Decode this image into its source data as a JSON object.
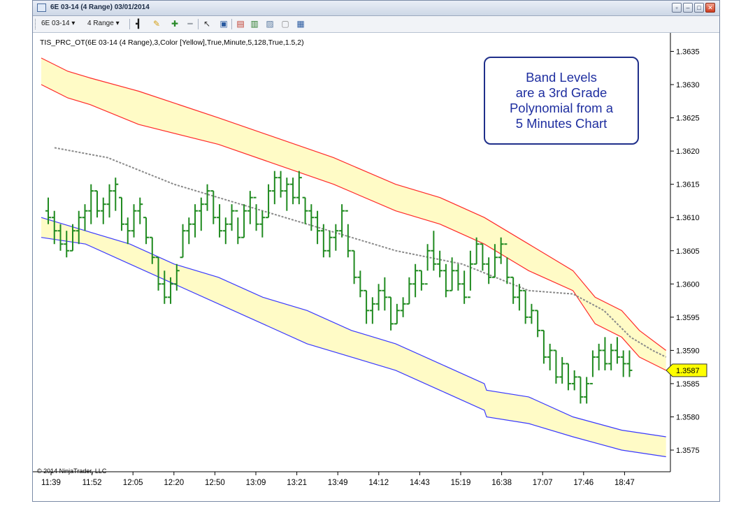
{
  "window": {
    "title": "6E 03-14 (4 Range)  03/01/2014",
    "controls": [
      "restore-icon",
      "minimize-icon",
      "maximize-icon",
      "close-icon"
    ]
  },
  "toolbar": {
    "instrument": "6E 03-14 ▾",
    "period": "4 Range ▾",
    "icons": [
      "bar-style-icon",
      "pencil-icon",
      "zoom-in-icon",
      "zoom-out-icon",
      "cursor-icon",
      "data-box-icon",
      "indicators-icon",
      "strategies-icon",
      "chart-properties-icon",
      "page-icon",
      "properties-icon"
    ]
  },
  "chart": {
    "indicator_label": "TIS_PRC_OT(6E 03-14 (4 Range),3,Color [Yellow],True,Minute,5,128,True,1.5,2)",
    "copyright": "© 2014 NinjaTrader, LLC",
    "price_tag": "1.3587",
    "note_lines": [
      "Band Levels",
      "are a 3rd Grade",
      "Polynomial from a",
      "5 Minutes Chart"
    ],
    "colors": {
      "band_fill": "#fffbc6",
      "upper_line": "#ff2a2a",
      "lower_line": "#3a3aff",
      "bars": "#1f8a1f",
      "midline": "#8a8a8a",
      "tag": "#ffff00"
    }
  },
  "chart_data": {
    "type": "line",
    "title": "",
    "xlabel": "",
    "ylabel": "",
    "ylim": [
      1.3571,
      1.3638
    ],
    "y_ticks": [
      "1.3635",
      "1.3630",
      "1.3625",
      "1.3620",
      "1.3615",
      "1.3610",
      "1.3605",
      "1.3600",
      "1.3595",
      "1.3590",
      "1.3585",
      "1.3580",
      "1.3575"
    ],
    "x_ticks": [
      "11:39",
      "11:52",
      "12:05",
      "12:20",
      "12:50",
      "13:09",
      "13:21",
      "13:49",
      "14:12",
      "14:43",
      "15:19",
      "16:38",
      "17:07",
      "17:46",
      "18:47"
    ],
    "last_price": 1.3587,
    "series": [
      {
        "kind": "band",
        "x": [
          0,
          6,
          11,
          22,
          40,
          66,
          80,
          90,
          100,
          110,
          120,
          125,
          131,
          135,
          141
        ],
        "upper": [
          1.3634,
          1.3632,
          1.3631,
          1.3629,
          1.3625,
          1.3619,
          1.3615,
          1.3613,
          1.361,
          1.3606,
          1.3602,
          1.3598,
          1.3596,
          1.3593,
          1.359
        ],
        "lower": [
          1.363,
          1.3628,
          1.3627,
          1.3624,
          1.3621,
          1.3615,
          1.3611,
          1.3609,
          1.3606,
          1.3602,
          1.3599,
          1.3594,
          1.3592,
          1.3589,
          1.3587
        ]
      },
      {
        "kind": "band",
        "x": [
          0,
          10,
          20,
          30,
          40,
          50,
          60,
          70,
          80,
          90,
          100,
          100.5,
          110,
          120,
          131,
          141
        ],
        "upper": [
          1.361,
          1.3608,
          1.3606,
          1.3603,
          1.3601,
          1.3598,
          1.3596,
          1.3593,
          1.3591,
          1.3588,
          1.3585,
          1.3584,
          1.3583,
          1.358,
          1.3578,
          1.3577
        ],
        "lower": [
          1.3607,
          1.3606,
          1.3603,
          1.36,
          1.3597,
          1.3594,
          1.3591,
          1.3589,
          1.3587,
          1.3584,
          1.3581,
          1.358,
          1.3579,
          1.3577,
          1.3575,
          1.3574
        ]
      },
      {
        "kind": "midline",
        "x": [
          3,
          15,
          30,
          50,
          65,
          80,
          95,
          110,
          120,
          127,
          133,
          138,
          141
        ],
        "y": [
          1.36205,
          1.3619,
          1.3615,
          1.3611,
          1.3608,
          1.3605,
          1.3603,
          1.3599,
          1.35985,
          1.3596,
          1.3592,
          1.359,
          1.3589
        ]
      },
      {
        "kind": "bars",
        "x_start": 3,
        "x_step": 1.0,
        "bars": [
          [
            1.3613,
            1.3609,
            1.3611,
            1.361
          ],
          [
            1.3611,
            1.3606,
            1.361,
            1.3608
          ],
          [
            1.3609,
            1.3605,
            1.3608,
            1.3606
          ],
          [
            1.3608,
            1.3604,
            1.3606,
            1.3605
          ],
          [
            1.3609,
            1.3605,
            1.3605,
            1.3608
          ],
          [
            1.3611,
            1.3606,
            1.3608,
            1.361
          ],
          [
            1.3612,
            1.3608,
            1.361,
            1.3611
          ],
          [
            1.3615,
            1.3609,
            1.3611,
            1.3614
          ],
          [
            1.3614,
            1.361,
            1.3614,
            1.3611
          ],
          [
            1.3613,
            1.3609,
            1.3611,
            1.3612
          ],
          [
            1.3615,
            1.361,
            1.3612,
            1.3614
          ],
          [
            1.3616,
            1.3611,
            1.3614,
            1.3615
          ],
          [
            1.3613,
            1.3608,
            1.3613,
            1.3609
          ],
          [
            1.361,
            1.3606,
            1.3609,
            1.3608
          ],
          [
            1.3612,
            1.3607,
            1.3608,
            1.3611
          ],
          [
            1.3613,
            1.3609,
            1.3611,
            1.3612
          ],
          [
            1.361,
            1.3606,
            1.361,
            1.3607
          ],
          [
            1.3607,
            1.3603,
            1.3607,
            1.3604
          ],
          [
            1.3604,
            1.3599,
            1.3604,
            1.36
          ],
          [
            1.3602,
            1.3597,
            1.36,
            1.3598
          ],
          [
            1.3601,
            1.3597,
            1.3598,
            1.36
          ],
          [
            1.3603,
            1.3599,
            1.36,
            1.3602
          ],
          [
            1.3609,
            1.3604,
            1.3604,
            1.3608
          ],
          [
            1.361,
            1.3606,
            1.3608,
            1.3609
          ],
          [
            1.3612,
            1.3607,
            1.3609,
            1.3611
          ],
          [
            1.3613,
            1.3608,
            1.3611,
            1.3612
          ],
          [
            1.3615,
            1.3611,
            1.3612,
            1.3614
          ],
          [
            1.3614,
            1.3609,
            1.3614,
            1.361
          ],
          [
            1.3612,
            1.3607,
            1.361,
            1.3608
          ],
          [
            1.361,
            1.3606,
            1.3608,
            1.3609
          ],
          [
            1.3612,
            1.3608,
            1.3609,
            1.3611
          ],
          [
            1.361,
            1.3606,
            1.3611,
            1.3607
          ],
          [
            1.3612,
            1.3607,
            1.3607,
            1.3611
          ],
          [
            1.3614,
            1.3609,
            1.3611,
            1.3613
          ],
          [
            1.3612,
            1.3608,
            1.3613,
            1.3609
          ],
          [
            1.3611,
            1.3607,
            1.3609,
            1.361
          ],
          [
            1.3615,
            1.361,
            1.361,
            1.3614
          ],
          [
            1.3617,
            1.3612,
            1.3614,
            1.3616
          ],
          [
            1.3617,
            1.3613,
            1.3616,
            1.3614
          ],
          [
            1.3616,
            1.3611,
            1.3614,
            1.3615
          ],
          [
            1.3616,
            1.3612,
            1.3615,
            1.3613
          ],
          [
            1.3617,
            1.3612,
            1.3613,
            1.3616
          ],
          [
            1.3613,
            1.3609,
            1.3613,
            1.3611
          ],
          [
            1.3612,
            1.3608,
            1.3611,
            1.361
          ],
          [
            1.3611,
            1.3606,
            1.361,
            1.3608
          ],
          [
            1.3609,
            1.3604,
            1.3608,
            1.3605
          ],
          [
            1.3608,
            1.3604,
            1.3605,
            1.3607
          ],
          [
            1.3609,
            1.3605,
            1.3607,
            1.3608
          ],
          [
            1.3612,
            1.3607,
            1.3608,
            1.3611
          ],
          [
            1.3609,
            1.3604,
            1.3611,
            1.3605
          ],
          [
            1.3605,
            1.36,
            1.3605,
            1.3601
          ],
          [
            1.3602,
            1.3598,
            1.3601,
            1.3599
          ],
          [
            1.3599,
            1.3594,
            1.3599,
            1.3596
          ],
          [
            1.3598,
            1.3594,
            1.3596,
            1.3597
          ],
          [
            1.36,
            1.3596,
            1.3597,
            1.3599
          ],
          [
            1.3601,
            1.3596,
            1.3599,
            1.3598
          ],
          [
            1.3598,
            1.3593,
            1.3598,
            1.3594
          ],
          [
            1.3597,
            1.3594,
            1.3594,
            1.3596
          ],
          [
            1.3598,
            1.3595,
            1.3596,
            1.3597
          ],
          [
            1.3601,
            1.3597,
            1.3597,
            1.36
          ],
          [
            1.3603,
            1.3598,
            1.36,
            1.3602
          ],
          [
            1.3602,
            1.3599,
            1.3602,
            1.36
          ],
          [
            1.3606,
            1.3602,
            1.36,
            1.3605
          ],
          [
            1.3608,
            1.3602,
            1.3605,
            1.3603
          ],
          [
            1.3605,
            1.3601,
            1.3603,
            1.3602
          ],
          [
            1.3603,
            1.3598,
            1.3602,
            1.3599
          ],
          [
            1.3604,
            1.3599,
            1.3599,
            1.3602
          ],
          [
            1.3603,
            1.3599,
            1.3602,
            1.36
          ],
          [
            1.3602,
            1.3597,
            1.36,
            1.3598
          ],
          [
            1.3605,
            1.3599,
            1.3598,
            1.3603
          ],
          [
            1.3607,
            1.3603,
            1.3603,
            1.3606
          ],
          [
            1.3606,
            1.3602,
            1.3606,
            1.3603
          ],
          [
            1.3604,
            1.36,
            1.3603,
            1.3601
          ],
          [
            1.3606,
            1.3601,
            1.3601,
            1.3604
          ],
          [
            1.3607,
            1.3603,
            1.3604,
            1.3606
          ],
          [
            1.3604,
            1.36,
            1.3606,
            1.3601
          ],
          [
            1.3601,
            1.3597,
            1.3601,
            1.3598
          ],
          [
            1.36,
            1.3596,
            1.3598,
            1.3599
          ],
          [
            1.3599,
            1.3594,
            1.3599,
            1.3595
          ],
          [
            1.3597,
            1.3594,
            1.3595,
            1.3596
          ],
          [
            1.3596,
            1.3592,
            1.3596,
            1.3593
          ],
          [
            1.3593,
            1.3588,
            1.3593,
            1.3589
          ],
          [
            1.3591,
            1.3587,
            1.3589,
            1.359
          ],
          [
            1.359,
            1.3585,
            1.359,
            1.3586
          ],
          [
            1.3589,
            1.3585,
            1.3586,
            1.3588
          ],
          [
            1.3588,
            1.3584,
            1.3588,
            1.3585
          ],
          [
            1.3587,
            1.3584,
            1.3585,
            1.3586
          ],
          [
            1.3586,
            1.3582,
            1.3586,
            1.3583
          ],
          [
            1.3586,
            1.3582,
            1.3583,
            1.3585
          ],
          [
            1.359,
            1.3586,
            1.3585,
            1.3589
          ],
          [
            1.3591,
            1.3587,
            1.3589,
            1.359
          ],
          [
            1.3592,
            1.3587,
            1.359,
            1.3588
          ],
          [
            1.3591,
            1.3587,
            1.3588,
            1.359
          ],
          [
            1.3592,
            1.3588,
            1.359,
            1.3589
          ],
          [
            1.359,
            1.3586,
            1.3589,
            1.3588
          ],
          [
            1.359,
            1.3586,
            1.3588,
            1.3587
          ]
        ]
      }
    ]
  }
}
